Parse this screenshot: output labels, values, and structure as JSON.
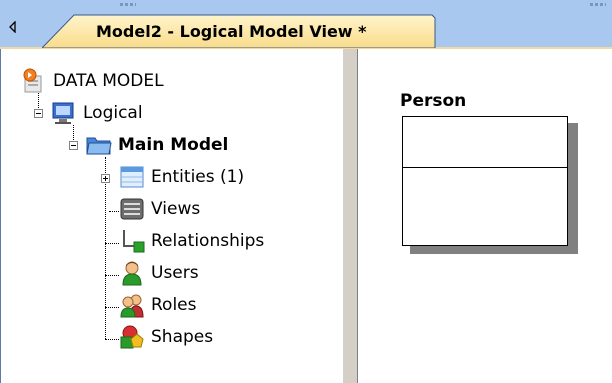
{
  "tab": {
    "title": "Model2 - Logical Model View *",
    "scroll_icon": "scroll-left-icon"
  },
  "tree": {
    "root": {
      "label": "DATA MODEL",
      "icon": "data-model-icon"
    },
    "logical": {
      "label": "Logical",
      "icon": "logical-model-icon"
    },
    "main_model": {
      "label": "Main Model",
      "icon": "folder-icon"
    },
    "children": [
      {
        "label": "Entities (1)",
        "icon": "entities-icon"
      },
      {
        "label": "Views",
        "icon": "views-icon"
      },
      {
        "label": "Relationships",
        "icon": "relationships-icon"
      },
      {
        "label": "Users",
        "icon": "users-icon"
      },
      {
        "label": "Roles",
        "icon": "roles-icon"
      },
      {
        "label": "Shapes",
        "icon": "shapes-icon"
      }
    ]
  },
  "diagram": {
    "entity": {
      "name": "Person"
    }
  },
  "colors": {
    "tab_bg": "#fde9a8",
    "strip_bg": "#a8c8f0",
    "shadow": "#808080"
  }
}
